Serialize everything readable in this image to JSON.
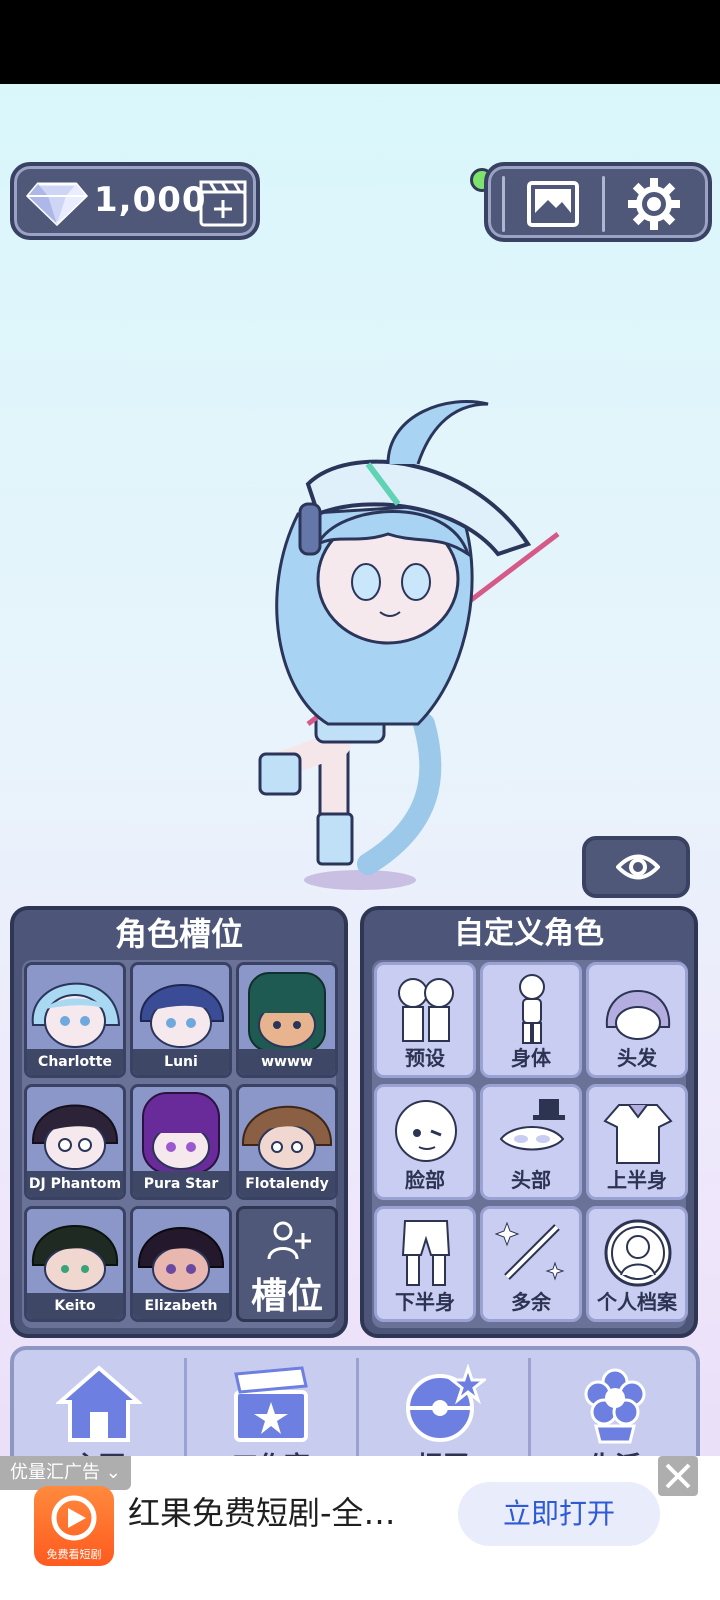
{
  "header": {
    "gems_count": "1,000"
  },
  "panels": {
    "character_slots_title": "角色槽位",
    "custom_character_title": "自定义角色"
  },
  "slots": [
    {
      "name": "Charlotte"
    },
    {
      "name": "Luni"
    },
    {
      "name": "wwww"
    },
    {
      "name": "DJ Phantom"
    },
    {
      "name": "Pura Star"
    },
    {
      "name": "Flotalendy"
    },
    {
      "name": "Keito"
    },
    {
      "name": "Elizabeth"
    }
  ],
  "add_slot_label": "槽位",
  "custom_tiles": [
    {
      "label": "预设"
    },
    {
      "label": "身体"
    },
    {
      "label": "头发"
    },
    {
      "label": "脸部"
    },
    {
      "label": "头部"
    },
    {
      "label": "上半身"
    },
    {
      "label": "下半身"
    },
    {
      "label": "多余"
    },
    {
      "label": "个人档案"
    }
  ],
  "bottom_nav": [
    {
      "label": "主页"
    },
    {
      "label": "工作室"
    },
    {
      "label": "扭蛋"
    },
    {
      "label": "生活"
    }
  ],
  "ad": {
    "source_label": "优量汇广告",
    "title": "红果免费短剧-全…",
    "cta": "立即打开",
    "logo_text": "免费看短剧"
  }
}
